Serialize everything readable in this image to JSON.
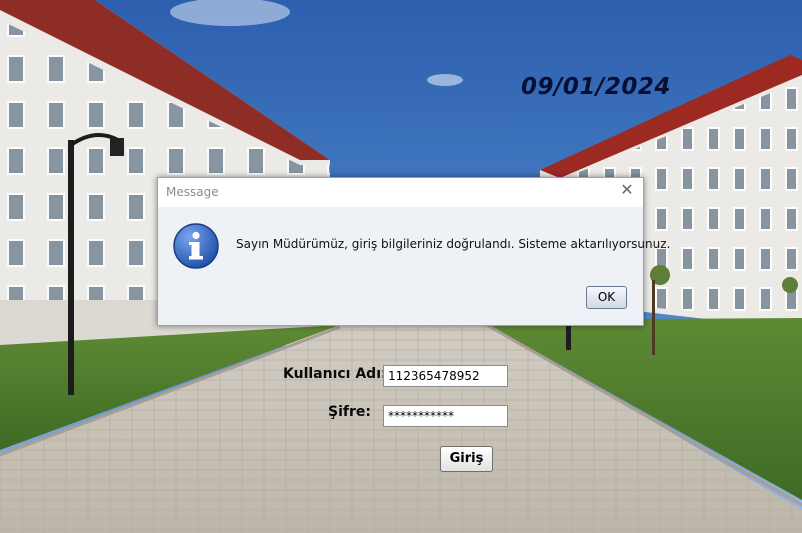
{
  "screen": {
    "date": "09/01/2024"
  },
  "login": {
    "username_label": "Kullanıcı Adı:",
    "username_value": "112365478952",
    "password_label": "Şifre:",
    "password_value": "***********",
    "submit_label": "Giriş"
  },
  "dialog": {
    "title": "Message",
    "close_glyph": "✕",
    "icon": "info-icon",
    "message": "Sayın Müdürümüz, giriş bilgileriniz doğrulandı. Sisteme aktarılıyorsunuz.",
    "ok_label": "OK"
  },
  "colors": {
    "sky": "#2f67b6",
    "roof": "#9d2a22",
    "grass": "#4f7f2e",
    "pavement": "#c9c3b8",
    "dialog_bg": "#eef1f6",
    "info_icon": "#2f5fb7"
  }
}
